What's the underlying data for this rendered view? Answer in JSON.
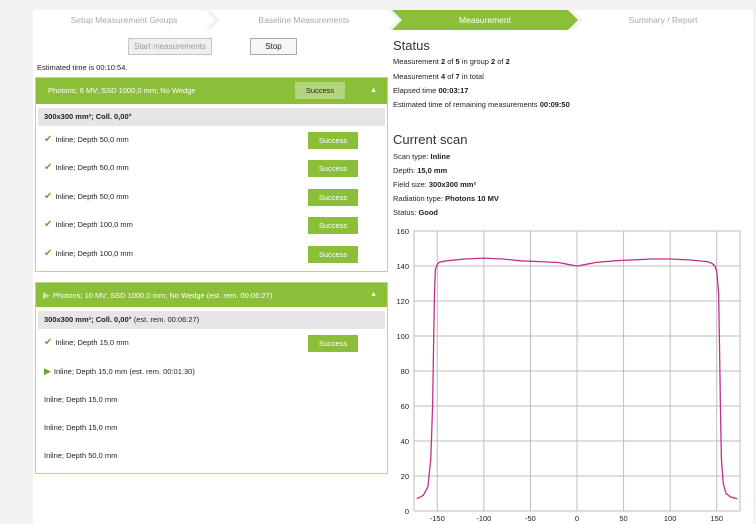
{
  "wizard": {
    "steps": [
      {
        "label": "Setup Measurement Groups",
        "active": false
      },
      {
        "label": "Baseline Measurements",
        "active": false
      },
      {
        "label": "Measurement",
        "active": true
      },
      {
        "label": "Summary / Report",
        "active": false
      }
    ]
  },
  "toolbar": {
    "start_label": "Start measurements",
    "stop_label": "Stop",
    "estimated_time": "Estimated time is 00:10:54."
  },
  "groups": [
    {
      "header": "Photons; 6 MV; SSD 1000,0 mm; No Wedge",
      "badge": "Success",
      "collapse_icon": "▲",
      "sub_header_bold": "300x300 mm²; Coll. 0,00°",
      "sub_header_extra": "",
      "rows": [
        {
          "label": "Inline; Depth 50,0 mm",
          "icon": "check",
          "badge": "Success"
        },
        {
          "label": "Inline; Depth 50,0 mm",
          "icon": "check",
          "badge": "Success"
        },
        {
          "label": "Inline; Depth 50,0 mm",
          "icon": "check",
          "badge": "Success"
        },
        {
          "label": "Inline; Depth 100,0 mm",
          "icon": "check",
          "badge": "Success"
        },
        {
          "label": "Inline; Depth 100,0 mm",
          "icon": "check",
          "badge": "Success"
        }
      ]
    },
    {
      "header": "Photons; 10 MV; SSD 1000,0 mm; No Wedge (est. rem. 00:06:27)",
      "collapse_icon": "▲",
      "sub_header_bold": "300x300 mm²; Coll. 0,00°",
      "sub_header_extra": " (est. rem. 00:06:27)",
      "rows": [
        {
          "label": "Inline; Depth 15,0 mm",
          "icon": "check",
          "badge": "Success"
        },
        {
          "label": "Inline; Depth 15,0 mm (est. rem. 00:01:30)",
          "icon": "play",
          "badge": ""
        },
        {
          "label": "Inline; Depth 15,0 mm",
          "icon": "",
          "badge": ""
        },
        {
          "label": "Inline; Depth 15,0 mm",
          "icon": "",
          "badge": ""
        },
        {
          "label": "Inline; Depth 50,0 mm",
          "icon": "",
          "badge": ""
        }
      ]
    }
  ],
  "status": {
    "title": "Status",
    "meas_prefix": "Measurement ",
    "meas_num": "2",
    "meas_of": " of ",
    "meas_total": "5",
    "meas_group": " in group ",
    "group_num": "2",
    "group_of": " of ",
    "group_total": "2",
    "total_prefix": "Measurement ",
    "total_num": "4",
    "total_of": " of ",
    "total_total": "7",
    "total_suffix": " in total",
    "elapsed_label": "Elapsed time ",
    "elapsed_value": "00:03:17",
    "remaining_label": "Estimated time of remaining measurements ",
    "remaining_value": "00:09:50"
  },
  "current_scan": {
    "title": "Current scan",
    "scan_type_label": "Scan type: ",
    "scan_type_value": "Inline",
    "depth_label": "Depth: ",
    "depth_value": "15,0 mm",
    "field_size_label": "Field size: ",
    "field_size_value": "300x300 mm²",
    "radiation_label": "Radiation type: ",
    "radiation_value": "Photons 10 MV",
    "status_label": "Status: ",
    "status_value": "Good"
  },
  "chart_data": {
    "type": "line",
    "title": "",
    "xlabel": "",
    "ylabel": "",
    "xlim": [
      -175,
      175
    ],
    "ylim": [
      0,
      160
    ],
    "x_ticks": [
      -150,
      -100,
      -50,
      0,
      50,
      100,
      150
    ],
    "y_ticks": [
      0,
      20,
      40,
      60,
      80,
      100,
      120,
      140,
      160
    ],
    "grid": true,
    "color": "#c0308a",
    "series": [
      {
        "x": [
          -172,
          -165,
          -160,
          -157,
          -155,
          -154,
          -153,
          -152,
          -150,
          -148,
          -145,
          -140,
          -120,
          -100,
          -80,
          -60,
          -40,
          -20,
          -10,
          -5,
          0,
          5,
          10,
          20,
          40,
          60,
          80,
          100,
          120,
          140,
          145,
          148,
          150,
          152,
          153,
          154,
          155,
          157,
          160,
          165,
          172
        ],
        "y": [
          7,
          9,
          14,
          30,
          60,
          95,
          125,
          138,
          141,
          142,
          142.5,
          143,
          144,
          144.5,
          144,
          143,
          142.5,
          142,
          141,
          140.5,
          140,
          140.5,
          141,
          142,
          143,
          143.5,
          144,
          144,
          143.5,
          142.5,
          141.5,
          140,
          137,
          125,
          95,
          60,
          30,
          16,
          10,
          8,
          7
        ]
      }
    ]
  }
}
